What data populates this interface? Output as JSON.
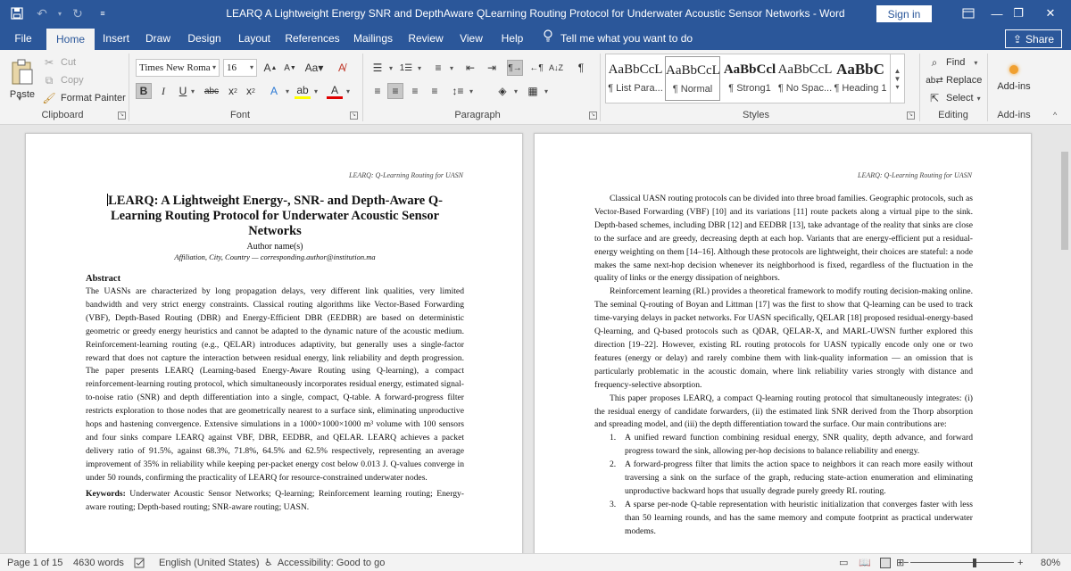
{
  "window": {
    "title": "LEARQ A Lightweight Energy SNR and DepthAware QLearning Routing Protocol for Underwater Acoustic Sensor Networks  -  Word",
    "signin_label": "Sign in",
    "share_label": "Share",
    "tell_me": "Tell me what you want to do"
  },
  "tabs": [
    "File",
    "Home",
    "Insert",
    "Draw",
    "Design",
    "Layout",
    "References",
    "Mailings",
    "Review",
    "View",
    "Help"
  ],
  "ribbon": {
    "clipboard": {
      "label": "Clipboard",
      "paste": "Paste",
      "cut": "Cut",
      "copy": "Copy",
      "format_painter": "Format Painter"
    },
    "font": {
      "label": "Font",
      "font_name": "Times New Roma",
      "font_size": "16"
    },
    "paragraph": {
      "label": "Paragraph"
    },
    "styles": {
      "label": "Styles",
      "items": [
        {
          "preview": "AaBbCcL",
          "name": "¶ List Para..."
        },
        {
          "preview": "AaBbCcL",
          "name": "¶ Normal"
        },
        {
          "preview": "AaBbCcl",
          "name": "¶ Strong1"
        },
        {
          "preview": "AaBbCcL",
          "name": "¶ No Spac..."
        },
        {
          "preview": "AaBbC",
          "name": "¶ Heading 1"
        }
      ]
    },
    "editing": {
      "label": "Editing",
      "find": "Find",
      "replace": "Replace",
      "select": "Select"
    },
    "addins": {
      "label": "Add-ins",
      "button": "Add-ins"
    }
  },
  "page1": {
    "header": "LEARQ: Q-Learning Routing for UASN",
    "title": "LEARQ: A Lightweight Energy-, SNR- and Depth-Aware Q-Learning Routing Protocol for Underwater Acoustic Sensor Networks",
    "author": "Author name(s)",
    "affiliation": "Affiliation, City, Country — corresponding.author@institution.ma",
    "abstract_heading": "Abstract",
    "abstract": "The UASNs are characterized by long propagation delays, very different link qualities, very limited bandwidth and very strict energy constraints. Classical routing algorithms like Vector-Based Forwarding (VBF), Depth-Based Routing (DBR) and Energy-Efficient DBR (EEDBR) are based on deterministic geometric or greedy energy heuristics and cannot be adapted to the dynamic nature of the acoustic medium. Reinforcement-learning routing (e.g., QELAR) introduces adaptivity, but generally uses a single-factor reward that does not capture the interaction between residual energy, link reliability and depth progression. The paper presents LEARQ (Learning-based Energy-Aware Routing using Q-learning), a compact reinforcement-learning routing protocol, which simultaneously incorporates residual energy, estimated signal-to-noise ratio (SNR) and depth differentiation into a single, compact, Q-table. A forward-progress filter restricts exploration to those nodes that are geometrically nearest to a surface sink, eliminating unproductive hops and hastening convergence. Extensive simulations in a 1000×1000×1000 m³ volume with 100 sensors and four sinks compare LEARQ against VBF, DBR, EEDBR, and QELAR. LEARQ achieves a packet delivery ratio of 91.5%, against 68.3%, 71.8%, 64.5% and 62.5% respectively, representing an average improvement of 35% in reliability while keeping per-packet energy cost below 0.013 J. Q-values converge in under 50 rounds, confirming the practicality of LEARQ for resource-constrained underwater nodes.",
    "keywords_label": "Keywords:",
    "keywords": "Underwater Acoustic Sensor Networks; Q-learning; Reinforcement learning routing; Energy-aware routing; Depth-based routing; SNR-aware routing; UASN."
  },
  "page2": {
    "header": "LEARQ: Q-Learning Routing for UASN",
    "paragraphs": [
      "Classical UASN routing protocols can be divided into three broad families. Geographic protocols, such as Vector-Based Forwarding (VBF) [10] and its variations [11] route packets along a virtual pipe to the sink. Depth-based schemes, including DBR [12] and EEDBR [13], take advantage of the reality that sinks are close to the surface and are greedy, decreasing depth at each hop. Variants that are energy-efficient put a residual-energy weighting on them [14–16]. Although these protocols are lightweight, their choices are stateful: a node makes the same next-hop decision whenever its neighborhood is fixed, regardless of the fluctuation in the quality of links or the energy dissipation of neighbors.",
      "Reinforcement learning (RL) provides a theoretical framework to modify routing decision-making online. The seminal Q-routing of Boyan and Littman [17] was the first to show that Q-learning can be used to track time-varying delays in packet networks. For UASN specifically, QELAR [18] proposed residual-energy-based Q-learning, and Q-based protocols such as QDAR, QELAR-X, and MARL-UWSN further explored this direction [19–22]. However, existing RL routing protocols for UASN typically encode only one or two features (energy or delay) and rarely combine them with link-quality information — an omission that is particularly problematic in the acoustic domain, where link reliability varies strongly with distance and frequency-selective absorption.",
      "This paper proposes LEARQ, a compact Q-learning routing protocol that simultaneously integrates: (i) the residual energy of candidate forwarders, (ii) the estimated link SNR derived from the Thorp absorption and spreading model, and (iii) the depth differentiation toward the surface. Our main contributions are:"
    ],
    "list": [
      {
        "num": "1.",
        "text": "A unified reward function combining residual energy, SNR quality, depth advance, and forward progress toward the sink, allowing per-hop decisions to balance reliability and energy."
      },
      {
        "num": "2.",
        "text": "A forward-progress filter that limits the action space to neighbors it can reach more easily without traversing a sink on the surface of the graph, reducing state-action enumeration and eliminating unproductive backward hops that usually degrade purely greedy RL routing."
      },
      {
        "num": "3.",
        "text": "A sparse per-node Q-table representation with heuristic initialization that converges faster with less than 50 learning rounds, and has the same memory and compute footprint as practical underwater modems."
      }
    ]
  },
  "status": {
    "page": "Page 1 of 15",
    "words": "4630 words",
    "language": "English (United States)",
    "accessibility": "Accessibility: Good to go",
    "zoom": "80%"
  },
  "colors": {
    "accent": "#2b579a",
    "ribbon_bg": "#f3f3f3",
    "doc_bg": "#e6e6e6"
  }
}
